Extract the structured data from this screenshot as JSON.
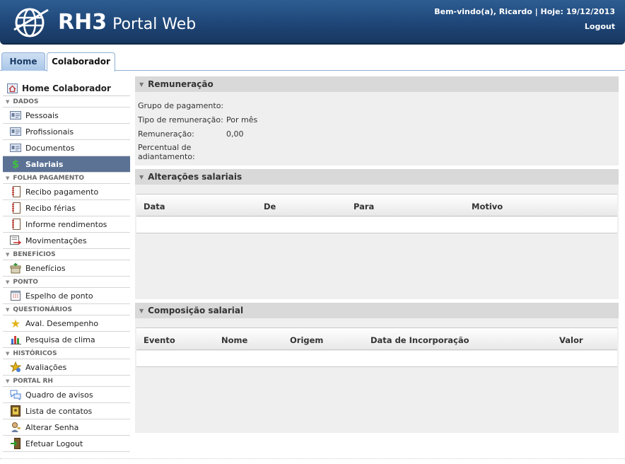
{
  "header": {
    "logo_rh": "RH3",
    "logo_portal": "Portal Web",
    "welcome": "Bem-vindo(a), Ricardo | Hoje: 19/12/2013",
    "logout": "Logout"
  },
  "tabs": [
    {
      "label": "Home"
    },
    {
      "label": "Colaborador"
    }
  ],
  "sidebar": {
    "home": "Home Colaborador",
    "sections": {
      "dados": "DADOS",
      "folha": "FOLHA PAGAMENTO",
      "beneficios": "BENEFÍCIOS",
      "ponto": "PONTO",
      "questionarios": "QUESTIONÁRIOS",
      "historicos": "HISTÓRICOS",
      "portal": "PORTAL RH"
    },
    "items": {
      "pessoais": "Pessoais",
      "profissionais": "Profissionais",
      "documentos": "Documentos",
      "salariais": "Salariais",
      "recibo_pagamento": "Recibo pagamento",
      "recibo_ferias": "Recibo férias",
      "informe_rendimentos": "Informe rendimentos",
      "movimentacoes": "Movimentações",
      "beneficios": "Benefícios",
      "espelho_ponto": "Espelho de ponto",
      "aval_desempenho": "Aval. Desempenho",
      "pesquisa_clima": "Pesquisa de clima",
      "avaliacoes": "Avaliações",
      "quadro_avisos": "Quadro de avisos",
      "lista_contatos": "Lista de contatos",
      "alterar_senha": "Alterar Senha",
      "efetuar_logout": "Efetuar Logout"
    }
  },
  "remuneracao": {
    "title": "Remuneração",
    "grupo_label": "Grupo de pagamento:",
    "tipo_label": "Tipo de remuneração:",
    "tipo_value": "Por mês",
    "remuneracao_label": "Remuneração:",
    "remuneracao_value": "0,00",
    "percentual_label_1": "Percentual de",
    "percentual_label_2": "adiantamento:"
  },
  "alteracoes": {
    "title": "Alterações salariais",
    "columns": [
      "Data",
      "De",
      "Para",
      "Motivo"
    ]
  },
  "composicao": {
    "title": "Composição salarial",
    "columns": [
      "Evento",
      "Nome",
      "Origem",
      "Data de Incorporação",
      "Valor"
    ]
  }
}
